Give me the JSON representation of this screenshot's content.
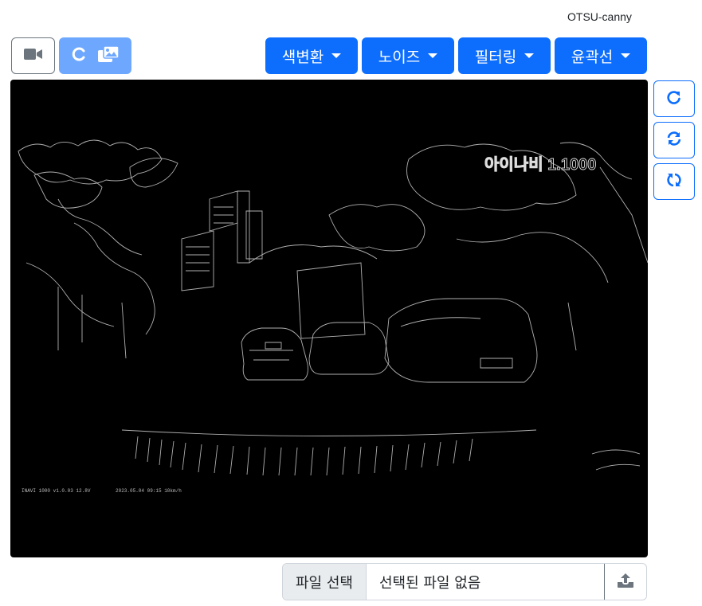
{
  "mode_label": "OTSU-canny",
  "toolbar": {
    "camera_button": {
      "icon": "video-camera-icon"
    },
    "gallery_button": {
      "icons": [
        "loading-spinner-icon",
        "images-icon"
      ]
    },
    "menus": [
      {
        "label": "색변환",
        "icon": "caret-down-icon"
      },
      {
        "label": "노이즈",
        "icon": "caret-down-icon"
      },
      {
        "label": "필터링",
        "icon": "caret-down-icon"
      },
      {
        "label": "윤곽선",
        "icon": "caret-down-icon"
      }
    ]
  },
  "side_buttons": [
    {
      "icon": "rotate-right-icon"
    },
    {
      "icon": "sync-icon"
    },
    {
      "icon": "sync-alt-icon"
    }
  ],
  "canvas": {
    "overlay_brand": "아이나비 1.1000",
    "overlay_footer_left": "INAVI 1000 v1.0.03 12.8V",
    "overlay_footer_right": "2023.05.04 09:15 10km/h"
  },
  "file_input": {
    "choose_label": "파일 선택",
    "status": "선택된 파일 없음",
    "upload_icon": "upload-icon"
  },
  "colors": {
    "primary": "#0d6efd",
    "primary_light": "#6ea8fe",
    "secondary": "#6c757d",
    "canvas_bg": "#000000"
  }
}
